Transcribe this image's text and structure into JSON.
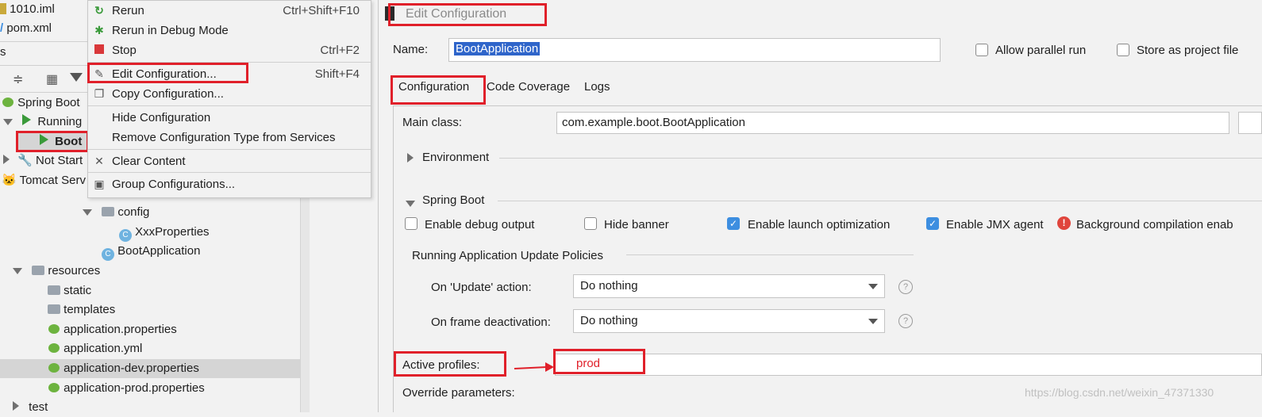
{
  "project": {
    "top_files": [
      "1010.iml",
      "pom.xml"
    ],
    "services_tab": "s",
    "services_tree": [
      {
        "label": "Spring Boot"
      },
      {
        "label": "Running"
      },
      {
        "label": "Boot"
      },
      {
        "label": "Not Start"
      },
      {
        "label": "Tomcat Serv"
      }
    ],
    "tree": [
      {
        "label": "config"
      },
      {
        "label": "XxxProperties"
      },
      {
        "label": "BootApplication"
      },
      {
        "label": "resources"
      },
      {
        "label": "static"
      },
      {
        "label": "templates"
      },
      {
        "label": "application.properties"
      },
      {
        "label": "application.yml"
      },
      {
        "label": "application-dev.properties"
      },
      {
        "label": "application-prod.properties"
      },
      {
        "label": "test"
      }
    ]
  },
  "menu": {
    "items": [
      {
        "label": "Rerun",
        "shortcut": "Ctrl+Shift+F10",
        "icon": "rerun-icon"
      },
      {
        "label": "Rerun in Debug Mode",
        "shortcut": "",
        "icon": "debug-rerun-icon"
      },
      {
        "label": "Stop",
        "shortcut": "Ctrl+F2",
        "icon": "stop-icon"
      },
      {
        "label": "Edit Configuration...",
        "shortcut": "Shift+F4",
        "icon": "edit-icon"
      },
      {
        "label": "Copy Configuration...",
        "shortcut": "",
        "icon": "copy-icon"
      },
      {
        "label": "Hide Configuration",
        "shortcut": "",
        "icon": ""
      },
      {
        "label": "Remove Configuration Type from Services",
        "shortcut": "",
        "icon": ""
      },
      {
        "label": "Clear Content",
        "shortcut": "",
        "icon": "close-icon"
      },
      {
        "label": "Group Configurations...",
        "shortcut": "",
        "icon": "group-icon"
      }
    ]
  },
  "dialog": {
    "title": "Edit Configuration",
    "name_label": "Name:",
    "name_value": "BootApplication",
    "allow_parallel": "Allow parallel run",
    "store_project": "Store as project file",
    "tabs": [
      "Configuration",
      "Code Coverage",
      "Logs"
    ],
    "main_class_label": "Main class:",
    "main_class_value": "com.example.boot.BootApplication",
    "environment": "Environment",
    "spring_boot": "Spring Boot",
    "enable_debug": "Enable debug output",
    "hide_banner": "Hide banner",
    "enable_launch": "Enable launch optimization",
    "enable_jmx": "Enable JMX agent",
    "background_compilation": "Background compilation enab",
    "policies_title": "Running Application Update Policies",
    "on_update_label": "On 'Update' action:",
    "on_update_value": "Do nothing",
    "on_frame_label": "On frame deactivation:",
    "on_frame_value": "Do nothing",
    "active_profiles_label": "Active profiles:",
    "active_profiles_value": "prod",
    "override_label": "Override parameters:",
    "watermark": "https://blog.csdn.net/weixin_47371330"
  },
  "colors": {
    "highlight": "#e0202a",
    "selection": "#2f65ca",
    "accent": "#3d8ee0"
  }
}
